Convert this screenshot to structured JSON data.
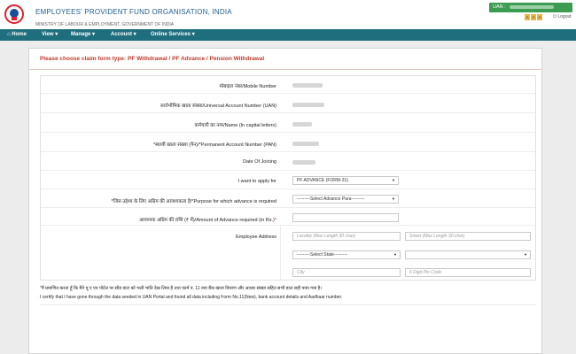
{
  "header": {
    "org_title": "EMPLOYEES' PROVIDENT FUND ORGANISATION, INDIA",
    "org_subtitle": "MINISTRY OF LABOUR & EMPLOYMENT, GOVERNMENT OF INDIA",
    "uan_label": "UAN :",
    "tools": [
      "A",
      "A",
      "A"
    ],
    "logout_label": "Logout"
  },
  "nav": {
    "items": [
      "Home",
      "View ▾",
      "Manage ▾",
      "Account ▾",
      "Online Services ▾"
    ]
  },
  "panel": {
    "title": "Please choose claim form type: PF Withdrawal / PF Advance / Pension Withdrawal"
  },
  "form": {
    "mobile_label": "मोबाइल नंबर/Mobile Number",
    "uan_label": "सार्वभौमिक खाता संख्या/Universal Account Number (UAN)",
    "name_label": "कर्मचारी का नाम/Name (In capital letters)",
    "pan_label": "*स्थायी खाता संख्या (पैन)/*Permanent Account Number (PAN)",
    "doj_label": "Date Of Joining",
    "apply_label": "I want to apply for",
    "apply_value": "PF ADVANCE (FORM-31)",
    "purpose_label": "*जिस उद्देश्य के लिए अग्रिम की आवश्यकता है/*Purpose for which advance is required",
    "purpose_value": "---------Select Advance Para---------",
    "amount_label": "आवश्यक अग्रिम की राशि (₹ में)/Amount of Advance required (in Rs.)",
    "amount_req": "*",
    "address_label": "Employee Address",
    "locality_placeholder": "Locality (Max Length 30 char)",
    "street_placeholder": "Street (Max Length 30 char)",
    "state_value": "---------Select State---------",
    "district_value": "",
    "city_placeholder": "City",
    "pin_placeholder": "6 Digit Pin Code"
  },
  "declaration": {
    "hindi": "\"मैं प्रमाणित करता हूँ कि मैंने यू ए एन पोर्टल पर सीड डाटा को भली भांति देख लिया है तथा फार्म नं. 11 नया बैंक खाता विवरण और आधार संख्या सहित सभी डाटा सही पाया गया है।",
    "english": "I certify that I have gone through the data seeded in UAN Portal and found all data including Form No.11(New), bank account details and Aadhaar number."
  },
  "colors": {
    "navbar": "#1f6e7e",
    "uan_box": "#3c9c52",
    "title_red": "#c0392b",
    "background": "#ececec"
  }
}
